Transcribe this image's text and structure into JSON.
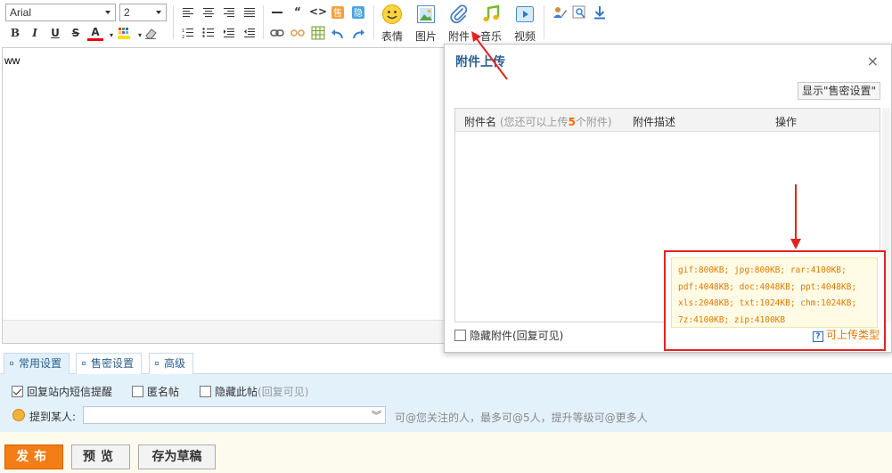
{
  "toolbar": {
    "font_family": "Arial",
    "font_size": "2",
    "emoji_label": "表情",
    "image_label": "图片",
    "attach_label": "附件",
    "music_label": "音乐",
    "video_label": "视频"
  },
  "editor": {
    "content": "ww"
  },
  "dialog": {
    "title": "附件上传",
    "close": "×",
    "show_sale_button": "显示\"售密设置\"",
    "col_name": "附件名",
    "col_name_hint_prefix": "(您还可以上传",
    "col_name_hint_count": "5",
    "col_name_hint_suffix": "个附件)",
    "col_desc": "附件描述",
    "col_action": "操作",
    "hide_attachment": "隐藏附件(回复可见)"
  },
  "file_types": {
    "lines": [
      "gif:800KB; jpg:800KB; rar:4100KB;",
      "pdf:4048KB; doc:4048KB; ppt:4048KB;",
      "xls:2048KB; txt:1024KB; chm:1024KB;",
      "7z:4100KB; zip:4100KB"
    ],
    "link": "可上传类型"
  },
  "tabs": [
    {
      "label": "常用设置",
      "active": true
    },
    {
      "label": "售密设置",
      "active": false
    },
    {
      "label": "高级",
      "active": false
    }
  ],
  "settings": {
    "reply_notify": {
      "label": "回复站内短信提醒",
      "checked": true
    },
    "anonymous": {
      "label": "匿名帖",
      "checked": false
    },
    "hide_post": {
      "label": "隐藏此帖",
      "note": "(回复可见)",
      "checked": false
    },
    "mention_label": "提到某人:",
    "mention_value": "",
    "mention_hint": "可@您关注的人，最多可@5人，提升等级可@更多人"
  },
  "actions": {
    "publish": "发布",
    "preview": "预览",
    "draft": "存为草稿"
  },
  "colors": {
    "accent_orange": "#f47d16",
    "highlight_red": "#e52222",
    "link_blue": "#2a5e8c"
  }
}
